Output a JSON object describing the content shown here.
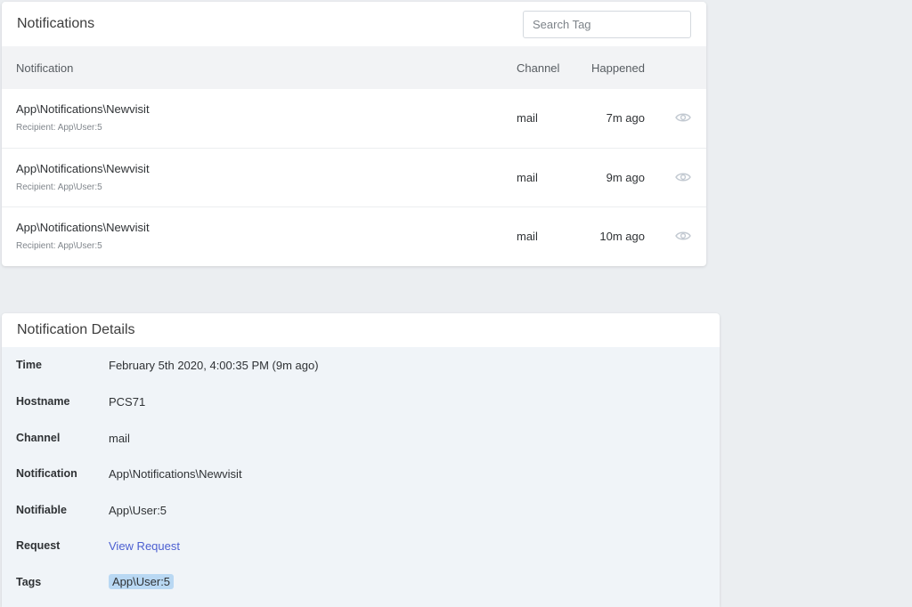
{
  "notifications_card": {
    "title": "Notifications",
    "search": {
      "placeholder": "Search Tag",
      "value": ""
    },
    "columns": {
      "notification": "Notification",
      "channel": "Channel",
      "happened": "Happened"
    },
    "rows": [
      {
        "title": "App\\Notifications\\Newvisit",
        "recipient": "Recipient: App\\User:5",
        "channel": "mail",
        "happened": "7m ago",
        "icon": "eye-icon"
      },
      {
        "title": "App\\Notifications\\Newvisit",
        "recipient": "Recipient: App\\User:5",
        "channel": "mail",
        "happened": "9m ago",
        "icon": "eye-icon"
      },
      {
        "title": "App\\Notifications\\Newvisit",
        "recipient": "Recipient: App\\User:5",
        "channel": "mail",
        "happened": "10m ago",
        "icon": "eye-icon"
      }
    ]
  },
  "details_card": {
    "title": "Notification Details",
    "fields": {
      "time": {
        "label": "Time",
        "value": "February 5th 2020, 4:00:35 PM (9m ago)"
      },
      "hostname": {
        "label": "Hostname",
        "value": "PCS71"
      },
      "channel": {
        "label": "Channel",
        "value": "mail"
      },
      "notification": {
        "label": "Notification",
        "value": "App\\Notifications\\Newvisit"
      },
      "notifiable": {
        "label": "Notifiable",
        "value": "App\\User:5"
      },
      "request": {
        "label": "Request",
        "value": "View Request"
      },
      "tags": {
        "label": "Tags",
        "value": "App\\User:5"
      }
    }
  },
  "colors": {
    "page_background": "#ebeef1",
    "link": "#4c5fd1",
    "tag_background": "#b9d8f3",
    "detail_background": "#f0f4f8",
    "table_header_background": "#f2f3f5"
  }
}
